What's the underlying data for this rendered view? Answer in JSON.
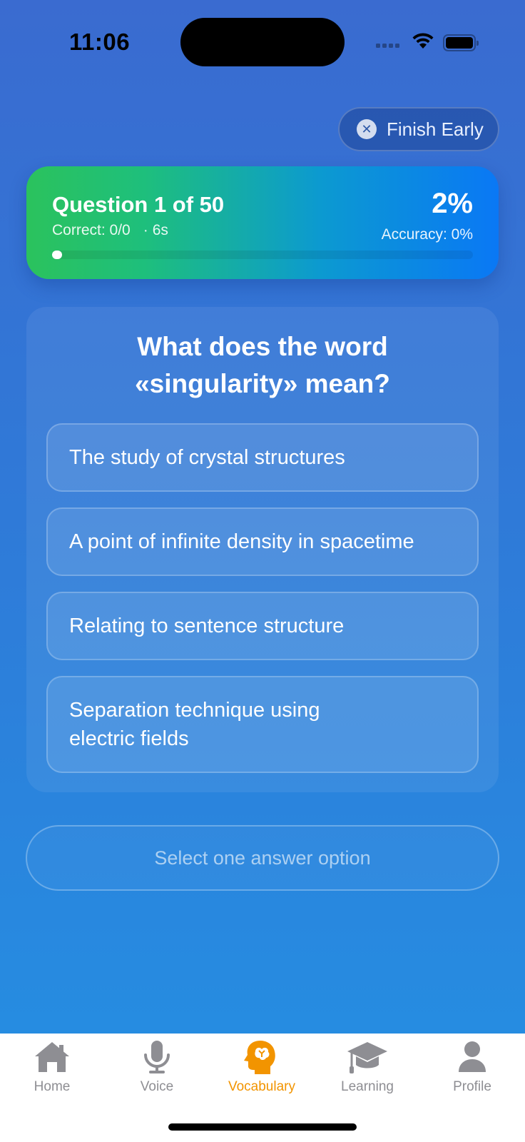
{
  "status": {
    "time": "11:06"
  },
  "finish_early": {
    "label": "Finish Early",
    "icon": "close-circle-icon"
  },
  "progress": {
    "title": "Question 1 of 50",
    "correct": "Correct: 0/0",
    "elapsed": "6s",
    "percent_label": "2%",
    "accuracy": "Accuracy: 0%",
    "fill_percent": 2
  },
  "quiz": {
    "question": "What does the word «singularity» mean?",
    "options": [
      "The study of crystal structures",
      "A point of infinite density in spacetime",
      "Relating to sentence structure",
      "Separation technique using electric fields"
    ],
    "submit_label": "Select one answer option"
  },
  "tabs": [
    {
      "label": "Home",
      "icon": "house-icon",
      "active": false
    },
    {
      "label": "Voice",
      "icon": "microphone-icon",
      "active": false
    },
    {
      "label": "Vocabulary",
      "icon": "brain-head-icon",
      "active": true
    },
    {
      "label": "Learning",
      "icon": "graduation-cap-icon",
      "active": false
    },
    {
      "label": "Profile",
      "icon": "person-icon",
      "active": false
    }
  ],
  "colors": {
    "accent": "#f29400",
    "inactive_tab": "#8e8e93"
  }
}
